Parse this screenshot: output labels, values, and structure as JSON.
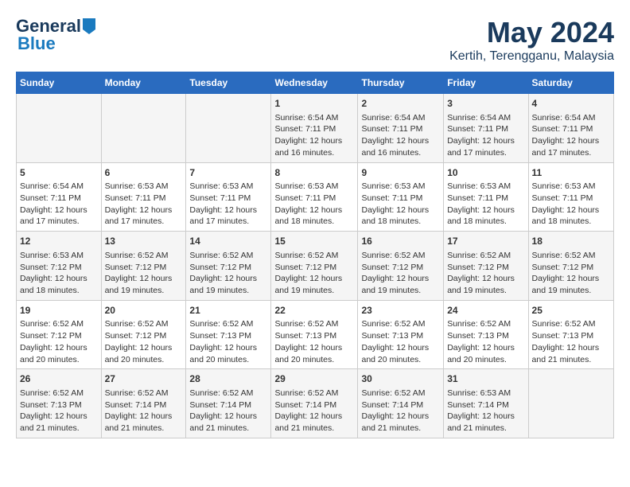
{
  "logo": {
    "general": "General",
    "blue": "Blue"
  },
  "title": {
    "month_year": "May 2024",
    "location": "Kertih, Terengganu, Malaysia"
  },
  "headers": [
    "Sunday",
    "Monday",
    "Tuesday",
    "Wednesday",
    "Thursday",
    "Friday",
    "Saturday"
  ],
  "weeks": [
    [
      {
        "day": "",
        "info": ""
      },
      {
        "day": "",
        "info": ""
      },
      {
        "day": "",
        "info": ""
      },
      {
        "day": "1",
        "info": "Sunrise: 6:54 AM\nSunset: 7:11 PM\nDaylight: 12 hours\nand 16 minutes."
      },
      {
        "day": "2",
        "info": "Sunrise: 6:54 AM\nSunset: 7:11 PM\nDaylight: 12 hours\nand 16 minutes."
      },
      {
        "day": "3",
        "info": "Sunrise: 6:54 AM\nSunset: 7:11 PM\nDaylight: 12 hours\nand 17 minutes."
      },
      {
        "day": "4",
        "info": "Sunrise: 6:54 AM\nSunset: 7:11 PM\nDaylight: 12 hours\nand 17 minutes."
      }
    ],
    [
      {
        "day": "5",
        "info": "Sunrise: 6:54 AM\nSunset: 7:11 PM\nDaylight: 12 hours\nand 17 minutes."
      },
      {
        "day": "6",
        "info": "Sunrise: 6:53 AM\nSunset: 7:11 PM\nDaylight: 12 hours\nand 17 minutes."
      },
      {
        "day": "7",
        "info": "Sunrise: 6:53 AM\nSunset: 7:11 PM\nDaylight: 12 hours\nand 17 minutes."
      },
      {
        "day": "8",
        "info": "Sunrise: 6:53 AM\nSunset: 7:11 PM\nDaylight: 12 hours\nand 18 minutes."
      },
      {
        "day": "9",
        "info": "Sunrise: 6:53 AM\nSunset: 7:11 PM\nDaylight: 12 hours\nand 18 minutes."
      },
      {
        "day": "10",
        "info": "Sunrise: 6:53 AM\nSunset: 7:11 PM\nDaylight: 12 hours\nand 18 minutes."
      },
      {
        "day": "11",
        "info": "Sunrise: 6:53 AM\nSunset: 7:11 PM\nDaylight: 12 hours\nand 18 minutes."
      }
    ],
    [
      {
        "day": "12",
        "info": "Sunrise: 6:53 AM\nSunset: 7:12 PM\nDaylight: 12 hours\nand 18 minutes."
      },
      {
        "day": "13",
        "info": "Sunrise: 6:52 AM\nSunset: 7:12 PM\nDaylight: 12 hours\nand 19 minutes."
      },
      {
        "day": "14",
        "info": "Sunrise: 6:52 AM\nSunset: 7:12 PM\nDaylight: 12 hours\nand 19 minutes."
      },
      {
        "day": "15",
        "info": "Sunrise: 6:52 AM\nSunset: 7:12 PM\nDaylight: 12 hours\nand 19 minutes."
      },
      {
        "day": "16",
        "info": "Sunrise: 6:52 AM\nSunset: 7:12 PM\nDaylight: 12 hours\nand 19 minutes."
      },
      {
        "day": "17",
        "info": "Sunrise: 6:52 AM\nSunset: 7:12 PM\nDaylight: 12 hours\nand 19 minutes."
      },
      {
        "day": "18",
        "info": "Sunrise: 6:52 AM\nSunset: 7:12 PM\nDaylight: 12 hours\nand 19 minutes."
      }
    ],
    [
      {
        "day": "19",
        "info": "Sunrise: 6:52 AM\nSunset: 7:12 PM\nDaylight: 12 hours\nand 20 minutes."
      },
      {
        "day": "20",
        "info": "Sunrise: 6:52 AM\nSunset: 7:12 PM\nDaylight: 12 hours\nand 20 minutes."
      },
      {
        "day": "21",
        "info": "Sunrise: 6:52 AM\nSunset: 7:13 PM\nDaylight: 12 hours\nand 20 minutes."
      },
      {
        "day": "22",
        "info": "Sunrise: 6:52 AM\nSunset: 7:13 PM\nDaylight: 12 hours\nand 20 minutes."
      },
      {
        "day": "23",
        "info": "Sunrise: 6:52 AM\nSunset: 7:13 PM\nDaylight: 12 hours\nand 20 minutes."
      },
      {
        "day": "24",
        "info": "Sunrise: 6:52 AM\nSunset: 7:13 PM\nDaylight: 12 hours\nand 20 minutes."
      },
      {
        "day": "25",
        "info": "Sunrise: 6:52 AM\nSunset: 7:13 PM\nDaylight: 12 hours\nand 21 minutes."
      }
    ],
    [
      {
        "day": "26",
        "info": "Sunrise: 6:52 AM\nSunset: 7:13 PM\nDaylight: 12 hours\nand 21 minutes."
      },
      {
        "day": "27",
        "info": "Sunrise: 6:52 AM\nSunset: 7:14 PM\nDaylight: 12 hours\nand 21 minutes."
      },
      {
        "day": "28",
        "info": "Sunrise: 6:52 AM\nSunset: 7:14 PM\nDaylight: 12 hours\nand 21 minutes."
      },
      {
        "day": "29",
        "info": "Sunrise: 6:52 AM\nSunset: 7:14 PM\nDaylight: 12 hours\nand 21 minutes."
      },
      {
        "day": "30",
        "info": "Sunrise: 6:52 AM\nSunset: 7:14 PM\nDaylight: 12 hours\nand 21 minutes."
      },
      {
        "day": "31",
        "info": "Sunrise: 6:53 AM\nSunset: 7:14 PM\nDaylight: 12 hours\nand 21 minutes."
      },
      {
        "day": "",
        "info": ""
      }
    ]
  ]
}
